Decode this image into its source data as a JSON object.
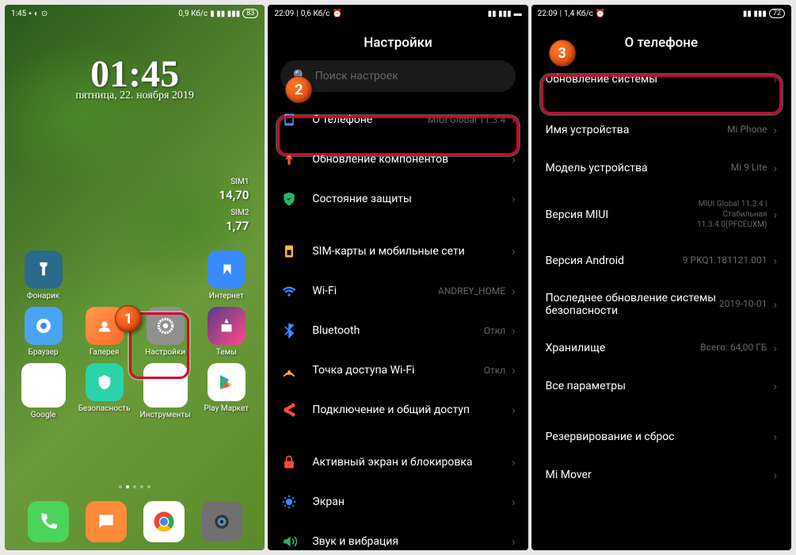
{
  "panel1": {
    "status": {
      "time": "1:45",
      "speed": "0,9 Кб/с",
      "battery": "83"
    },
    "clock": {
      "time": "01:45",
      "date": "пятница, 22. ноября 2019"
    },
    "sim": [
      {
        "label": "SIM1",
        "value": "14,70"
      },
      {
        "label": "SIM2",
        "value": "1,77"
      }
    ],
    "apps": [
      {
        "name": "Фонарик",
        "icon": "flashlight"
      },
      {
        "name": "Интернет",
        "icon": "internet"
      },
      {
        "name": "Браузер",
        "icon": "browser"
      },
      {
        "name": "Галерея",
        "icon": "gallery"
      },
      {
        "name": "Настройки",
        "icon": "settings"
      },
      {
        "name": "Темы",
        "icon": "themes"
      },
      {
        "name": "Google",
        "icon": "google"
      },
      {
        "name": "Безопасность",
        "icon": "security"
      },
      {
        "name": "Инструменты",
        "icon": "tools"
      },
      {
        "name": "Play Маркет",
        "icon": "play"
      }
    ],
    "step": "1"
  },
  "panel2": {
    "status": {
      "time": "22:09",
      "speed": "0,6 Кб/с"
    },
    "title": "Настройки",
    "search_placeholder": "Поиск настроек",
    "step": "2",
    "groups": [
      [
        {
          "icon": "phone-info",
          "color": "#3a8aff",
          "label": "О телефоне",
          "value": "MIUI Global 11.3.4",
          "highlighted": true
        },
        {
          "icon": "arrow-up",
          "color": "#ff4a3a",
          "label": "Обновление компонентов",
          "value": ""
        },
        {
          "icon": "shield",
          "color": "#2ab46a",
          "label": "Состояние защиты",
          "value": ""
        }
      ],
      [
        {
          "icon": "sim",
          "color": "#ffb43a",
          "label": "SIM-карты и мобильные сети",
          "value": ""
        },
        {
          "icon": "wifi",
          "color": "#3a8aff",
          "label": "Wi-Fi",
          "value": "ANDREY_HOME"
        },
        {
          "icon": "bluetooth",
          "color": "#3a8aff",
          "label": "Bluetooth",
          "value": "Откл"
        },
        {
          "icon": "hotspot",
          "color": "#ffb43a",
          "label": "Точка доступа Wi-Fi",
          "value": "Откл"
        },
        {
          "icon": "share",
          "color": "#ff4a3a",
          "label": "Подключение и общий доступ",
          "value": ""
        }
      ],
      [
        {
          "icon": "lock",
          "color": "#ff4a3a",
          "label": "Активный экран и блокировка",
          "value": ""
        },
        {
          "icon": "display",
          "color": "#3a8aff",
          "label": "Экран",
          "value": ""
        },
        {
          "icon": "sound",
          "color": "#2ab46a",
          "label": "Звук и вибрация",
          "value": ""
        }
      ]
    ]
  },
  "panel3": {
    "status": {
      "time": "22:09",
      "speed": "1,4 Кб/с",
      "battery": "72"
    },
    "title": "О телефоне",
    "step": "3",
    "groups": [
      [
        {
          "label": "Обновление системы",
          "value": "",
          "highlighted": true
        }
      ],
      [
        {
          "label": "Имя устройства",
          "value": "Mi Phone"
        },
        {
          "label": "Модель устройства",
          "value": "Mi 9 Lite"
        },
        {
          "label": "Версия MIUI",
          "value": "MIUI Global 11.3.4 | Стабильная 11.3.4.0(PFCEUXM)",
          "small": true
        },
        {
          "label": "Версия Android",
          "value": "9 PKQ1.181121.001"
        },
        {
          "label": "Последнее обновление системы безопасности",
          "value": "2019-10-01"
        },
        {
          "label": "Хранилище",
          "value": "Всего: 64,00 ГБ"
        },
        {
          "label": "Все параметры",
          "value": ""
        }
      ],
      [
        {
          "label": "Резервирование и сброс",
          "value": ""
        },
        {
          "label": "Mi Mover",
          "value": ""
        }
      ]
    ]
  }
}
